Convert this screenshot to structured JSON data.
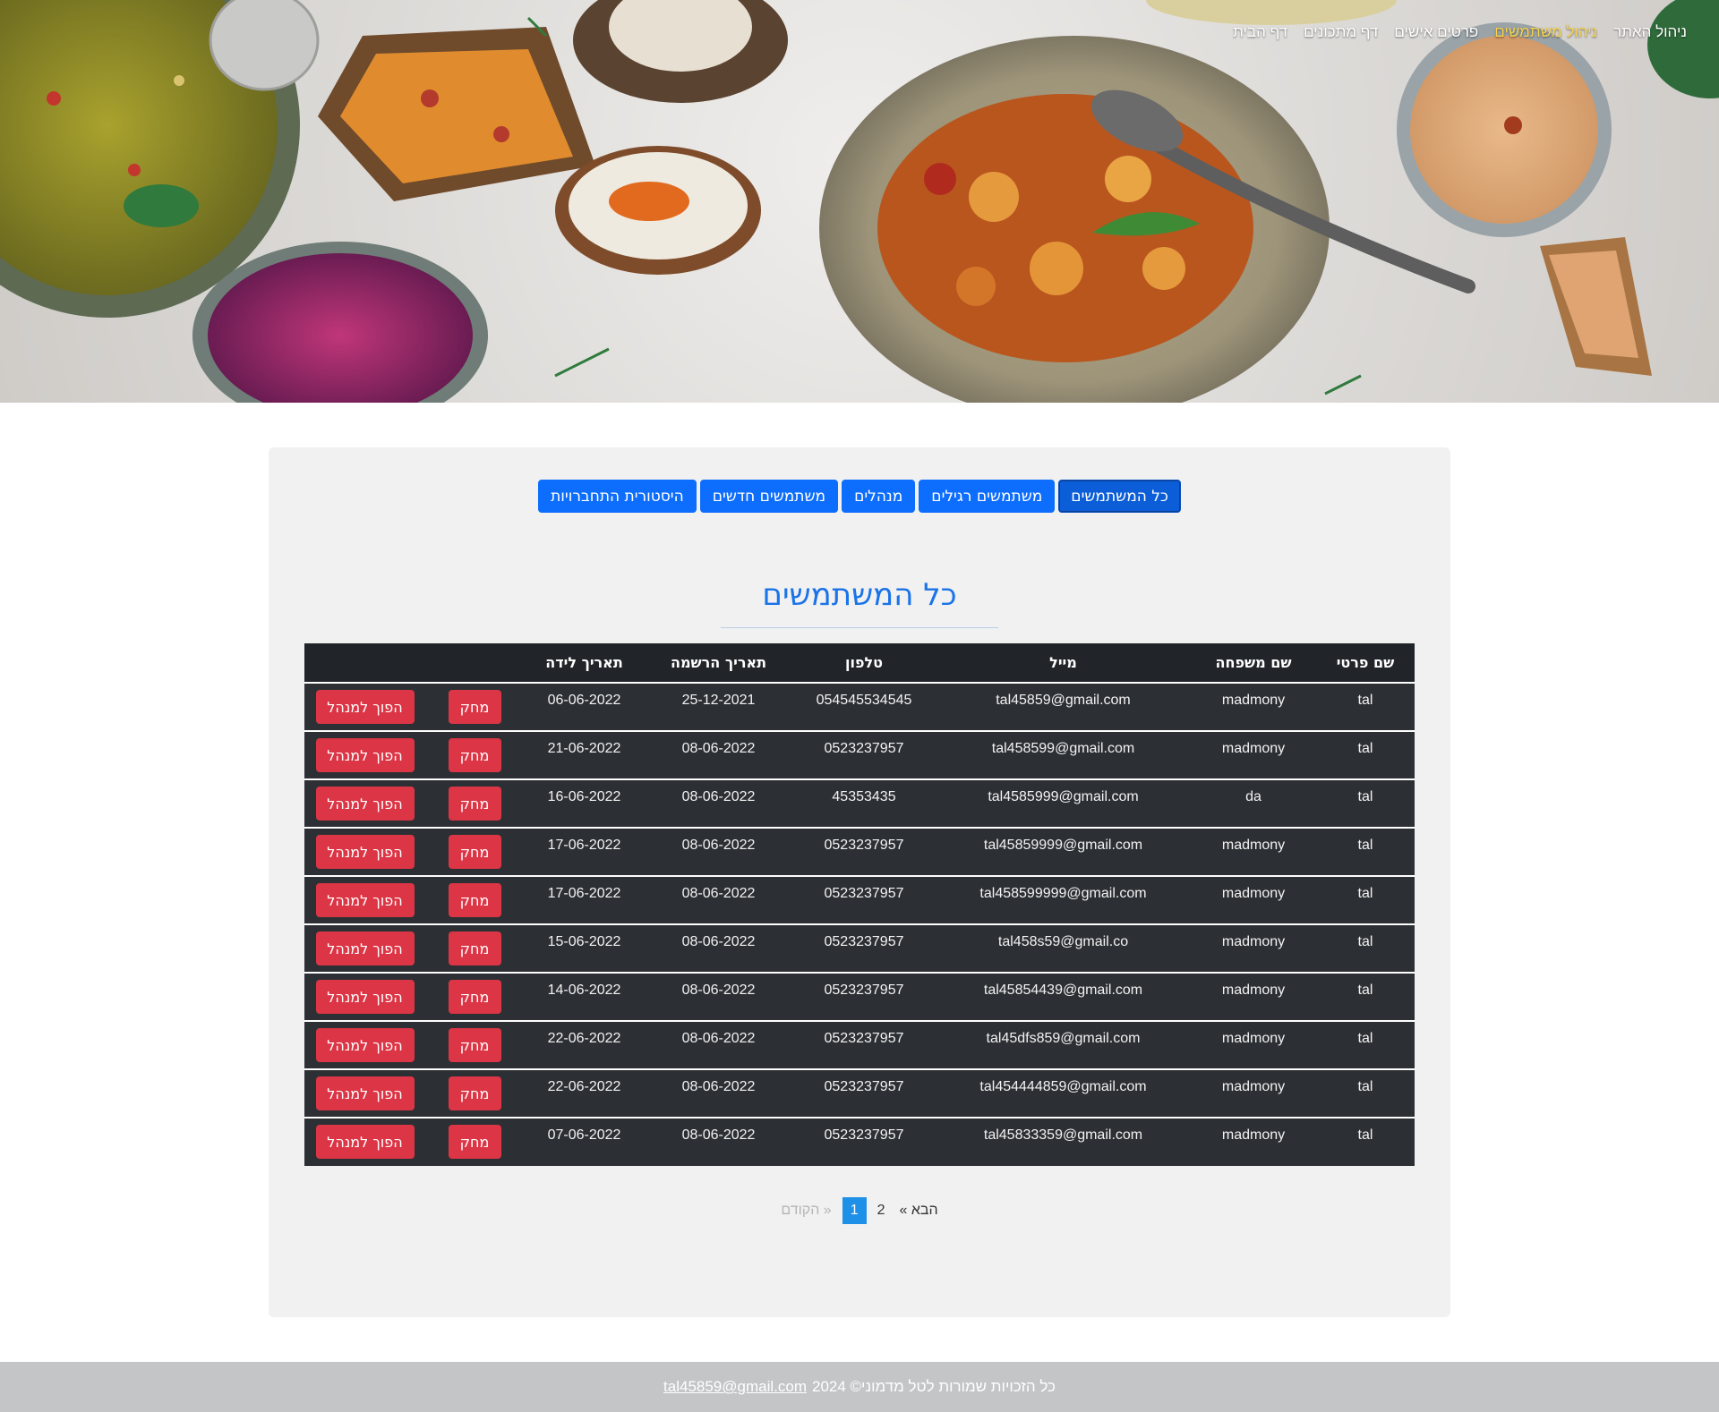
{
  "nav": {
    "items": [
      {
        "label": "דף הבית",
        "active": false
      },
      {
        "label": "דף מתכונים",
        "active": false
      },
      {
        "label": "פרטים אישים",
        "active": false
      },
      {
        "label": "ניהול משתמשים",
        "active": true
      },
      {
        "label": "ניהול האתר",
        "active": false
      }
    ]
  },
  "tabs": [
    {
      "label": "כל המשתמשים",
      "active": true
    },
    {
      "label": "משתמשים רגילים",
      "active": false
    },
    {
      "label": "מנהלים",
      "active": false
    },
    {
      "label": "משתמשים חדשים",
      "active": false
    },
    {
      "label": "היסטורית התחברויות",
      "active": false
    }
  ],
  "page_title": "כל המשתמשים",
  "table": {
    "headers": [
      "שם פרטי",
      "שם משפחה",
      "מייל",
      "טלפון",
      "תאריך הרשמה",
      "תאריך לידה",
      "",
      ""
    ],
    "delete_label": "מחק",
    "promote_label": "הפוך למנהל",
    "rows": [
      [
        "tal",
        "madmony",
        "tal45859@gmail.com",
        "054545534545",
        "25-12-2021",
        "06-06-2022"
      ],
      [
        "tal",
        "madmony",
        "tal458599@gmail.com",
        "0523237957",
        "08-06-2022",
        "21-06-2022"
      ],
      [
        "tal",
        "da",
        "tal4585999@gmail.com",
        "45353435",
        "08-06-2022",
        "16-06-2022"
      ],
      [
        "tal",
        "madmony",
        "tal45859999@gmail.com",
        "0523237957",
        "08-06-2022",
        "17-06-2022"
      ],
      [
        "tal",
        "madmony",
        "tal458599999@gmail.com",
        "0523237957",
        "08-06-2022",
        "17-06-2022"
      ],
      [
        "tal",
        "madmony",
        "tal458s59@gmail.co",
        "0523237957",
        "08-06-2022",
        "15-06-2022"
      ],
      [
        "tal",
        "madmony",
        "tal45854439@gmail.com",
        "0523237957",
        "08-06-2022",
        "14-06-2022"
      ],
      [
        "tal",
        "madmony",
        "tal45dfs859@gmail.com",
        "0523237957",
        "08-06-2022",
        "22-06-2022"
      ],
      [
        "tal",
        "madmony",
        "tal454444859@gmail.com",
        "0523237957",
        "08-06-2022",
        "22-06-2022"
      ],
      [
        "tal",
        "madmony",
        "tal45833359@gmail.com",
        "0523237957",
        "08-06-2022",
        "07-06-2022"
      ]
    ]
  },
  "pagination": {
    "prev": "« הקודם",
    "pages": [
      "1",
      "2"
    ],
    "current": "1",
    "next": "הבא »"
  },
  "footer": {
    "text": "כל הזכויות שמורות לטל מדמוני© 2024",
    "email": "tal45859@gmail.com"
  },
  "colors": {
    "primary": "#0d6efd",
    "danger": "#dc3545",
    "table_dark": "#212529",
    "title": "#1a73e8",
    "footer": "#c4c5c7"
  }
}
